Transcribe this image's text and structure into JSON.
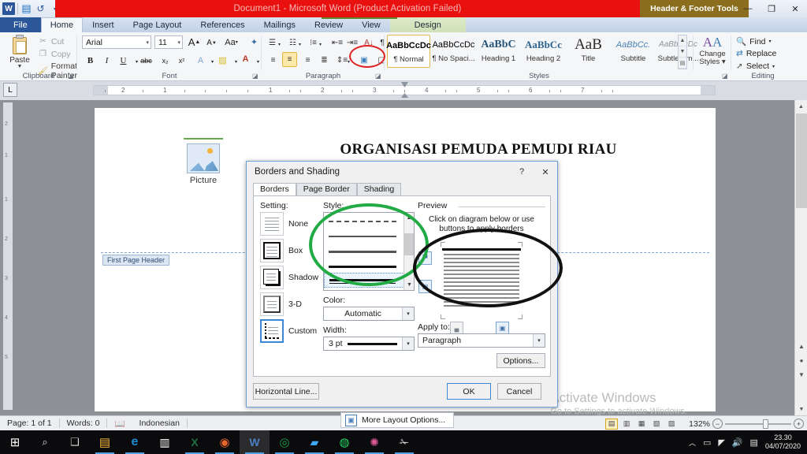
{
  "window": {
    "title": "Document1 - Microsoft Word (Product Activation Failed)",
    "contextual_tools": "Header & Footer Tools",
    "minimize": "—",
    "restore": "❐",
    "close": "✕",
    "help": "?"
  },
  "quick_access": {
    "app_icon": "W",
    "save_icon": "save-icon",
    "undo_icon": "undo-icon",
    "redo_icon": "redo-icon",
    "customize_icon": "customize-icon"
  },
  "tabs": [
    {
      "label": "File",
      "kind": "file"
    },
    {
      "label": "Home",
      "kind": "active"
    },
    {
      "label": "Insert",
      "kind": "normal"
    },
    {
      "label": "Page Layout",
      "kind": "normal"
    },
    {
      "label": "References",
      "kind": "normal"
    },
    {
      "label": "Mailings",
      "kind": "normal"
    },
    {
      "label": "Review",
      "kind": "normal"
    },
    {
      "label": "View",
      "kind": "normal"
    },
    {
      "label": "Design",
      "kind": "design"
    }
  ],
  "ribbon": {
    "clipboard": {
      "label": "Clipboard",
      "paste": "Paste",
      "paste_arrow": "▼",
      "cut": "Cut",
      "copy": "Copy",
      "format_painter": "Format Painter"
    },
    "font": {
      "label": "Font",
      "font_name": "Arial",
      "font_size": "11",
      "grow_font": "A",
      "shrink_font": "A",
      "change_case": "Aa",
      "clear_formatting": "clear-formatting-icon",
      "bold": "B",
      "italic": "I",
      "underline": "U",
      "strikethrough": "abc",
      "subscript": "x₂",
      "superscript": "x²",
      "text_effects": "A",
      "highlight": "ab",
      "font_color": "A"
    },
    "paragraph": {
      "label": "Paragraph",
      "bullets": "bullets-icon",
      "numbering": "numbering-icon",
      "multilevel": "multilevel-list-icon",
      "decrease_indent": "decrease-indent-icon",
      "increase_indent": "increase-indent-icon",
      "sort": "sort-icon",
      "show_marks": "¶",
      "align_left": "align-left-icon",
      "center": "align-center-icon",
      "align_right": "align-right-icon",
      "justify": "justify-icon",
      "line_spacing": "line-spacing-icon",
      "shading": "shading-icon",
      "borders": "borders-icon"
    },
    "styles": {
      "label": "Styles",
      "items": [
        {
          "preview": "AaBbCcDc",
          "name": "¶ Normal",
          "selected": true
        },
        {
          "preview": "AaBbCcDc",
          "name": "¶ No Spaci...",
          "selected": false
        },
        {
          "preview": "AaBbC",
          "name": "Heading 1",
          "selected": false
        },
        {
          "preview": "AaBbCc",
          "name": "Heading 2",
          "selected": false
        },
        {
          "preview": "AaB",
          "name": "Title",
          "selected": false
        },
        {
          "preview": "AaBbCc.",
          "name": "Subtitle",
          "selected": false
        },
        {
          "preview": "AaBbCcDc",
          "name": "Subtle Em...",
          "selected": false
        }
      ],
      "change_styles": "Change\nStyles"
    },
    "change_styles": {
      "line1": "Change",
      "line2": "Styles ▾"
    },
    "editing": {
      "label": "Editing",
      "find": "Find",
      "replace": "Replace",
      "select": "Select"
    }
  },
  "ruler": {
    "tab_selector": "L",
    "ticks": [
      "2",
      "1",
      "1",
      "2",
      "3",
      "4",
      "5",
      "6",
      "7"
    ]
  },
  "document": {
    "picture_placeholder_caption": "Picture",
    "heading": "ORGANISASI PEMUDA PEMUDI RIAU",
    "header_tag": "First Page Header"
  },
  "watermark": {
    "line1": "Activate Windows",
    "line2": "Go to Settings to activate Windows."
  },
  "dialog": {
    "title": "Borders and Shading",
    "help_btn": "?",
    "close_btn": "✕",
    "tabs": [
      {
        "label": "Borders",
        "active": true
      },
      {
        "label": "Page Border",
        "active": false
      },
      {
        "label": "Shading",
        "active": false
      }
    ],
    "setting_label": "Setting:",
    "settings": [
      {
        "name": "None",
        "selected": false
      },
      {
        "name": "Box",
        "selected": false
      },
      {
        "name": "Shadow",
        "selected": false
      },
      {
        "name": "3-D",
        "selected": false
      },
      {
        "name": "Custom",
        "selected": true
      }
    ],
    "style_label": "Style:",
    "styles": [
      {
        "kind": "dotted",
        "selected": false
      },
      {
        "kind": "thin",
        "selected": false
      },
      {
        "kind": "medium",
        "selected": false
      },
      {
        "kind": "thick",
        "selected": false
      },
      {
        "kind": "thick-double",
        "selected": true
      }
    ],
    "color_label": "Color:",
    "color_value": "Automatic",
    "width_label": "Width:",
    "width_value": "3 pt",
    "preview_label": "Preview",
    "preview_help_line1": "Click on diagram below or use",
    "preview_help_line2": "buttons to apply borders",
    "apply_to_label": "Apply to:",
    "apply_to_value": "Paragraph",
    "options_btn": "Options...",
    "horizontal_line_btn": "Horizontal Line...",
    "ok_btn": "OK",
    "cancel_btn": "Cancel"
  },
  "tooltip": {
    "label": "More Layout Options..."
  },
  "statusbar": {
    "page": "Page: 1 of 1",
    "words": "Words: 0",
    "proofing_icon": "proofing-errors-icon",
    "language": "Indonesian",
    "zoom": "132%",
    "zoom_out": "−",
    "zoom_in": "+",
    "views": [
      "print-layout",
      "full-screen-reading",
      "web-layout",
      "outline",
      "draft"
    ]
  },
  "taskbar": {
    "start": "start-icon",
    "search": "search-icon",
    "task_view": "task-view-icon",
    "apps": [
      {
        "name": "file-explorer-icon",
        "glyph": "▣",
        "color": "#f2b33d",
        "running": true,
        "active": false
      },
      {
        "name": "edge-icon",
        "glyph": "e",
        "color": "#1f8ad2",
        "running": true,
        "active": false
      },
      {
        "name": "store-icon",
        "glyph": "▤",
        "color": "#ffffff",
        "running": false,
        "active": false
      },
      {
        "name": "excel-icon",
        "glyph": "X",
        "color": "#1d7044",
        "running": true,
        "active": false
      },
      {
        "name": "firefox-icon",
        "glyph": "◉",
        "color": "#e8662a",
        "running": true,
        "active": false
      },
      {
        "name": "word-icon",
        "glyph": "W",
        "color": "#2b579a",
        "running": true,
        "active": true
      },
      {
        "name": "chrome-icon",
        "glyph": "◎",
        "color": "#1aa14b",
        "running": true,
        "active": false
      },
      {
        "name": "photos-icon",
        "glyph": "▰",
        "color": "#3fa9f5",
        "running": true,
        "active": false
      },
      {
        "name": "whatsapp-icon",
        "glyph": "◍",
        "color": "#25d366",
        "running": true,
        "active": false
      },
      {
        "name": "paint-icon",
        "glyph": "✺",
        "color": "#e05a9a",
        "running": true,
        "active": false
      },
      {
        "name": "snipping-tool-icon",
        "glyph": "✁",
        "color": "#dddddd",
        "running": true,
        "active": false
      }
    ],
    "tray": {
      "show_hidden": "︿",
      "battery": "battery-icon",
      "wifi": "wifi-icon",
      "volume": "volume-icon",
      "action_center": "action-center-icon",
      "time": "23.30",
      "date": "04/07/2020"
    }
  }
}
